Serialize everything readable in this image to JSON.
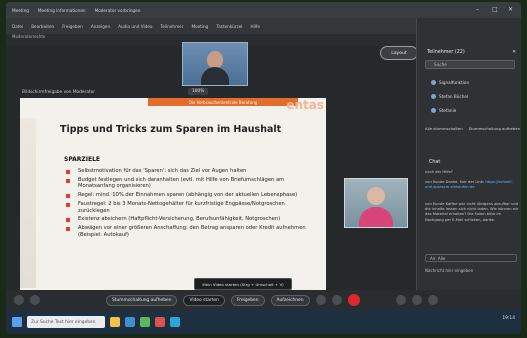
{
  "window": {
    "tabs": [
      "Meeting",
      "Meeting Informationen",
      "Moderator vorbringen"
    ],
    "controls": [
      "–",
      "□",
      "✕"
    ]
  },
  "menubar": [
    "Datei",
    "Bearbeiten",
    "Freigeben",
    "Anzeigen",
    "Audio und Video",
    "Teilnehmer",
    "Meeting",
    "Tastenkürzel",
    "Hilfe"
  ],
  "toolbar": [
    "Moderatorrechte"
  ],
  "stage": {
    "layout_label": "Layout",
    "share_label": "Bildschirmfreigabe von Moderator",
    "zoom": "100%"
  },
  "slide": {
    "banner": "Die Verbraucherzentrale Beratung",
    "logo": "entas",
    "title": "Tipps und Tricks zum Sparen im Haushalt",
    "section": "SPARZIELE",
    "bullets": [
      "Selbstmotivation für das 'Sparen': sich das Ziel vor Augen halten",
      "Budget festlegen und sich daranhalten (evtl. mit Hilfe von Briefumschlägen am Monatsanfang organisieren)",
      "Regel: mind. 10% der Einnahmen sparen (abhängig von der aktuellen Lebensphase)",
      "Faustregel: 2 bis 3 Monats-Nettogehälter für kurzfristige Engpässe/Notgroschen zurücklegen",
      "Existenz absichern (Haftpflicht-Versicherung, Berufsunfähigkeit, Notgroschen)",
      "Abwägen vor einer größeren Anschaffung: den Betrag ansparen oder Kredit aufnehmen (Beispiel: Autokauf)"
    ]
  },
  "panel": {
    "title": "Teilnehmer (22)",
    "search_placeholder": "Suche",
    "participants": [
      "Signalfunktion",
      "Stefan Büchel",
      "Stefanie"
    ],
    "tabs": [
      "Alle stummschalten",
      "Stummschaltung aufheben"
    ],
    "chat_title": "Chat",
    "chat_messages": [
      {
        "sender": "nach der Hilfe?",
        "text": ""
      },
      {
        "sender": "von Kunde",
        "text": "Danke, hier der Link:",
        "link": "https://schnell-und-sparsam-einkaufen.de"
      },
      {
        "sender": "von Kunde",
        "text": "Kaffee war nicht übrigens abrufbar und die Inhalte lassen sich nicht laden. Wie können wir das Material erhalten? Die Folien bitte im Nachgang per E-Mail schicken, danke."
      }
    ],
    "chat_to": "An: Alle",
    "chat_input_placeholder": "Nachricht hier eingeben"
  },
  "controls": {
    "mute": "Stummschaltung aufheben",
    "video": "Video starten",
    "share": "Freigeben",
    "record": "Aufzeichnen",
    "tooltip": "Mein Video starten (Strg + Umschalt + V)"
  },
  "taskbar": {
    "search_placeholder": "Zur Suche Text hier eingeben",
    "clock": "19:14"
  },
  "colors": {
    "banner": "#e46c2c",
    "bullet": "#e0402a",
    "end_call": "#e0262e",
    "link": "#6fb6ff"
  }
}
